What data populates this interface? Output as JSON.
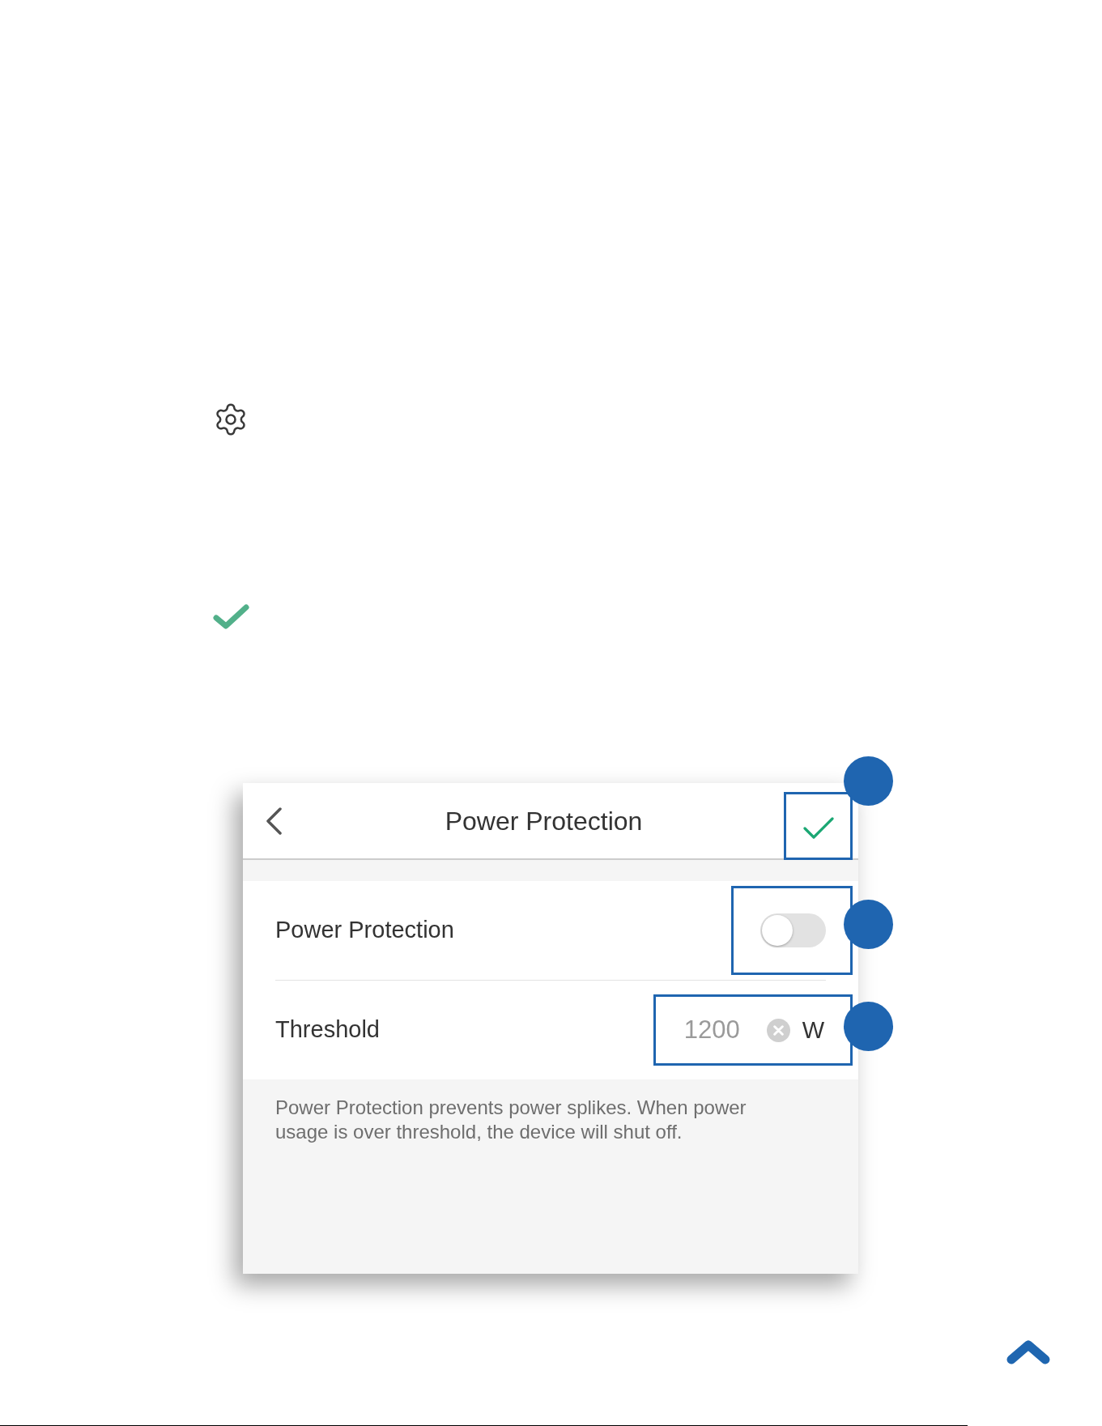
{
  "screen": {
    "header": {
      "title": "Power Protection"
    },
    "settings": [
      {
        "kind": "toggle",
        "label": "Power Protection",
        "on": false
      },
      {
        "kind": "input",
        "label": "Threshold",
        "value": "1200",
        "unit": "W"
      }
    ],
    "note": "Power Protection prevents power splikes. When power usage is over threshold, the device will shut off."
  }
}
